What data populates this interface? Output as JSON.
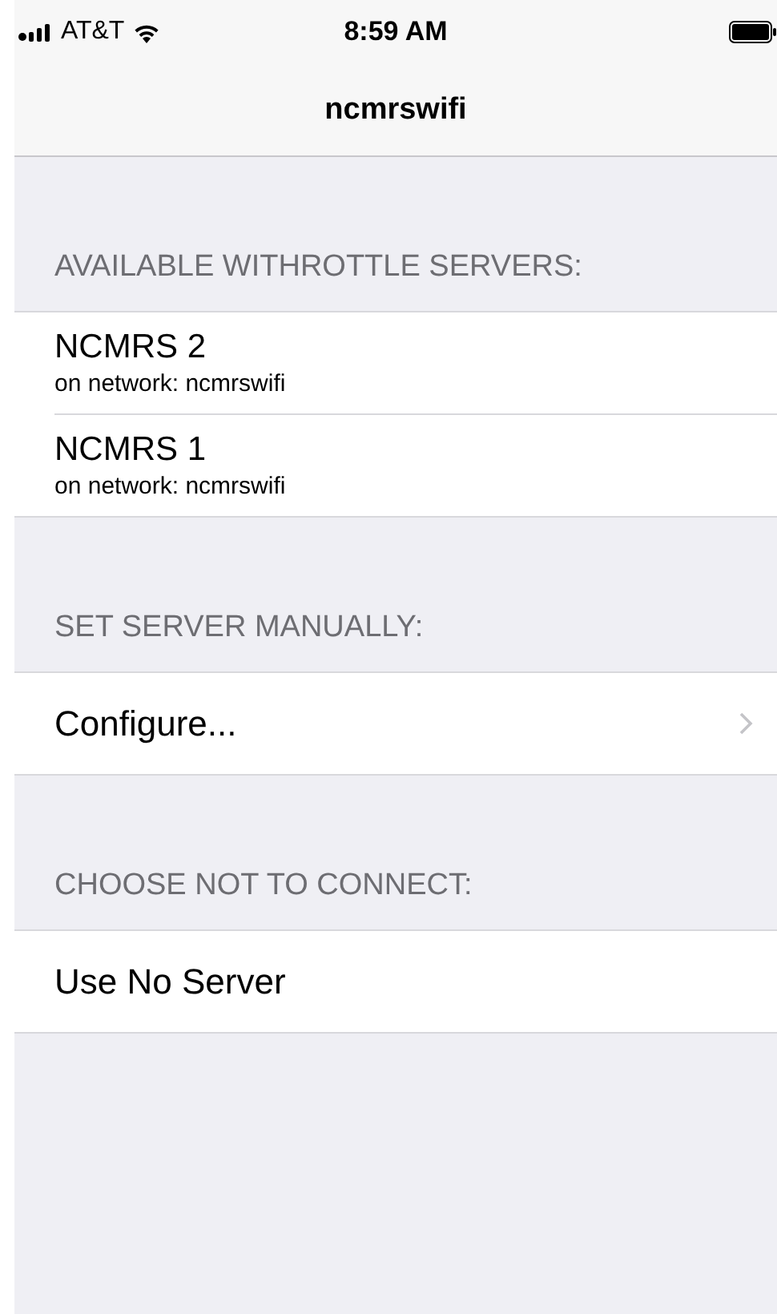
{
  "status_bar": {
    "carrier": "AT&T",
    "time": "8:59 AM"
  },
  "nav_bar": {
    "title": "ncmrswifi"
  },
  "sections": [
    {
      "header": "AVAILABLE WITHROTTLE SERVERS:",
      "rows": [
        {
          "kind": "server",
          "title": "NCMRS 2",
          "subtitle": "on network: ncmrswifi"
        },
        {
          "kind": "server",
          "title": "NCMRS 1",
          "subtitle": "on network: ncmrswifi"
        }
      ]
    },
    {
      "header": "SET SERVER MANUALLY:",
      "rows": [
        {
          "kind": "disclosure",
          "title": "Configure..."
        }
      ]
    },
    {
      "header": "CHOOSE NOT TO CONNECT:",
      "rows": [
        {
          "kind": "plain",
          "title": "Use No Server"
        }
      ]
    }
  ]
}
